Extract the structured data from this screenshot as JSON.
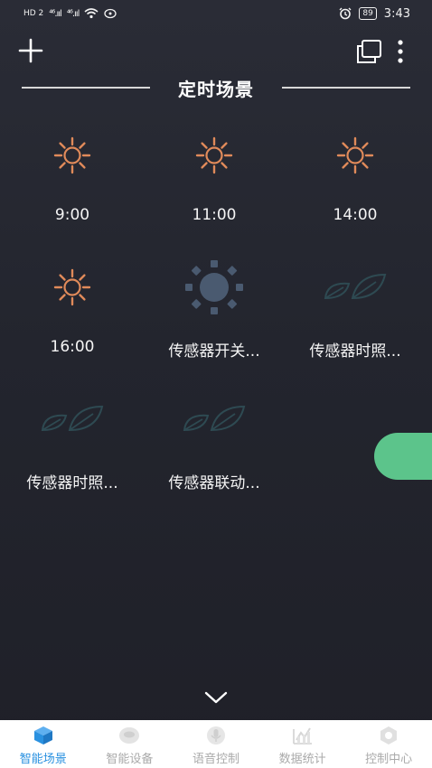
{
  "status_bar": {
    "left_text": "HD 2",
    "signal_1": "⁴⁶.ııl",
    "signal_2": "⁴⁶.ııl",
    "battery": "89",
    "time": "3:43"
  },
  "header": {
    "title": "定时场景"
  },
  "scenes": [
    {
      "label": "9:00",
      "icon": "sun-outline-icon"
    },
    {
      "label": "11:00",
      "icon": "sun-outline-icon"
    },
    {
      "label": "14:00",
      "icon": "sun-outline-icon"
    },
    {
      "label": "16:00",
      "icon": "sun-outline-icon"
    },
    {
      "label": "传感器开关...",
      "icon": "sun-filled-icon"
    },
    {
      "label": "传感器时照...",
      "icon": "leaf-icon"
    },
    {
      "label": "传感器时照...",
      "icon": "leaf-icon"
    },
    {
      "label": "传感器联动...",
      "icon": "leaf-icon"
    }
  ],
  "tabs": [
    {
      "label": "智能场景",
      "active": true,
      "icon": "cube-icon"
    },
    {
      "label": "智能设备",
      "active": false,
      "icon": "device-icon"
    },
    {
      "label": "语音控制",
      "active": false,
      "icon": "microphone-icon"
    },
    {
      "label": "数据统计",
      "active": false,
      "icon": "chart-icon"
    },
    {
      "label": "控制中心",
      "active": false,
      "icon": "hexagon-icon"
    }
  ],
  "colors": {
    "accent_tab": "#2a91e0",
    "sun_outline": "#e08a5a",
    "sun_filled": "#4a5a70",
    "leaf": "#2e4a52",
    "fab": "#5cc48b"
  }
}
